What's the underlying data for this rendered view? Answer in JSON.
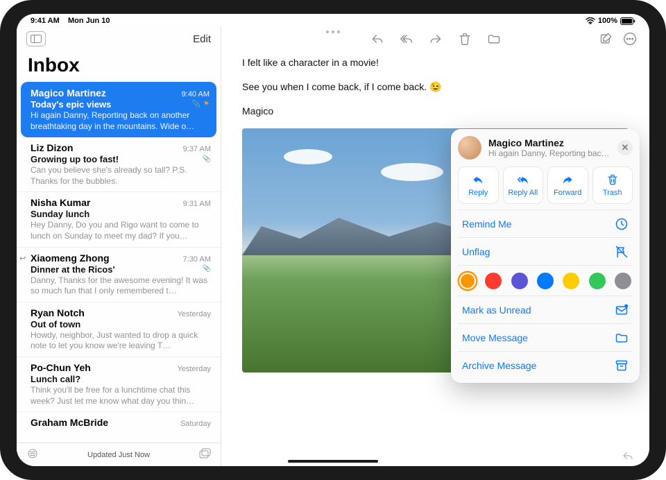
{
  "status_bar": {
    "time": "9:41 AM",
    "date": "Mon Jun 10",
    "battery": "100%"
  },
  "sidebar": {
    "edit_label": "Edit",
    "title": "Inbox",
    "updated": "Updated Just Now",
    "messages": [
      {
        "sender": "Magico Martinez",
        "time": "9:40 AM",
        "subject": "Today's epic views",
        "preview": "Hi again Danny, Reporting back on another breathtaking day in the mountains. Wide o…",
        "selected": true,
        "has_attachment": true,
        "flagged": true
      },
      {
        "sender": "Liz Dizon",
        "time": "9:37 AM",
        "subject": "Growing up too fast!",
        "preview": "Can you believe she's already so tall? P.S. Thanks for the bubbles.",
        "has_attachment": true
      },
      {
        "sender": "Nisha Kumar",
        "time": "9:31 AM",
        "subject": "Sunday lunch",
        "preview": "Hey Danny, Do you and Rigo want to come to lunch on Sunday to meet my dad? If you…"
      },
      {
        "sender": "Xiaomeng Zhong",
        "time": "7:30 AM",
        "subject": "Dinner at the Ricos'",
        "preview": "Danny, Thanks for the awesome evening! It was so much fun that I only remembered t…",
        "replied": true,
        "has_attachment": true
      },
      {
        "sender": "Ryan Notch",
        "time": "Yesterday",
        "subject": "Out of town",
        "preview": "Howdy, neighbor, Just wanted to drop a quick note to let you know we're leaving T…"
      },
      {
        "sender": "Po-Chun Yeh",
        "time": "Yesterday",
        "subject": "Lunch call?",
        "preview": "Think you'll be free for a lunchtime chat this week? Just let me know what day you thin…"
      },
      {
        "sender": "Graham McBride",
        "time": "Saturday",
        "subject": "",
        "preview": ""
      }
    ]
  },
  "email": {
    "line1": "I felt like a character in a movie!",
    "line2": "See you when I come back, if I come back. 😉",
    "signoff": "Magico"
  },
  "popover": {
    "sender": "Magico Martinez",
    "preview": "Hi again Danny, Reporting back o…",
    "actions": {
      "reply": "Reply",
      "reply_all": "Reply All",
      "forward": "Forward",
      "trash": "Trash"
    },
    "menu": {
      "remind_me": "Remind Me",
      "unflag": "Unflag",
      "mark_unread": "Mark as Unread",
      "move": "Move Message",
      "archive": "Archive Message"
    },
    "flag_colors": [
      "#ff9500",
      "#ff3b30",
      "#5856d6",
      "#007aff",
      "#ffcc00",
      "#34c759",
      "#8e8e93"
    ]
  }
}
